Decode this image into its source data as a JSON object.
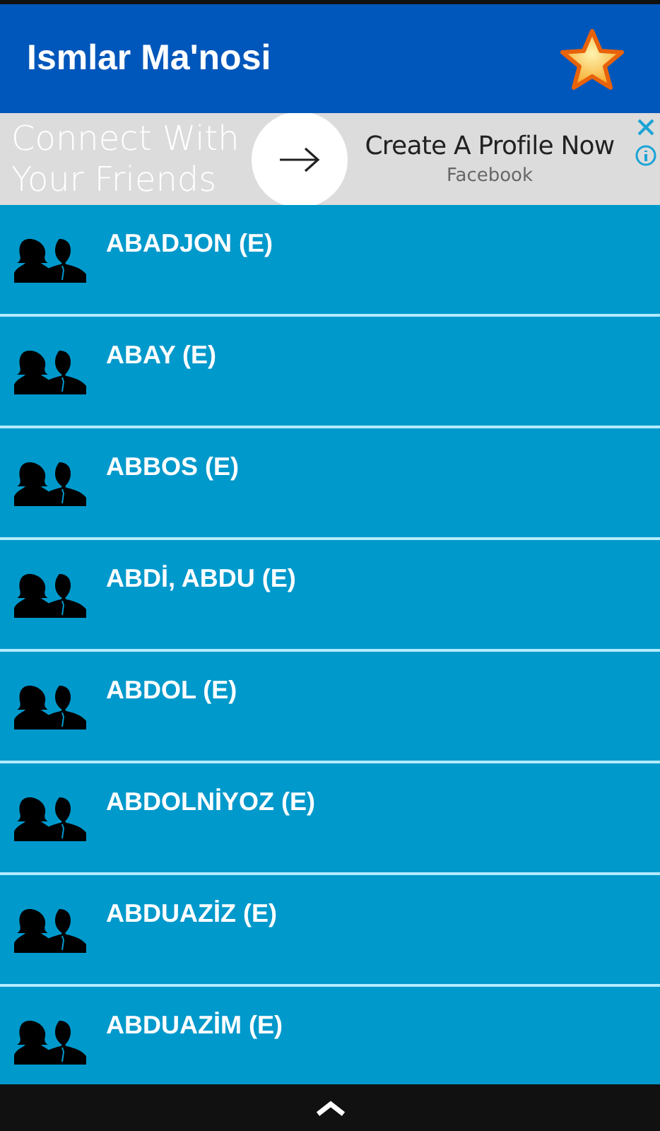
{
  "app_bar": {
    "title": "Ismlar Ma'nosi"
  },
  "ad": {
    "headline": "Connect With Your Friends",
    "cta": "Create A Profile Now",
    "advertiser": "Facebook"
  },
  "names": [
    {
      "label": "ABADJON (E)"
    },
    {
      "label": "ABAY (E)"
    },
    {
      "label": "ABBOS (E)"
    },
    {
      "label": "ABDİ, ABDU (E)"
    },
    {
      "label": "ABDOL (E)"
    },
    {
      "label": "ABDOLNİYOZ (E)"
    },
    {
      "label": "ABDUAZİZ (E)"
    },
    {
      "label": "ABDUAZİM (E)"
    }
  ]
}
